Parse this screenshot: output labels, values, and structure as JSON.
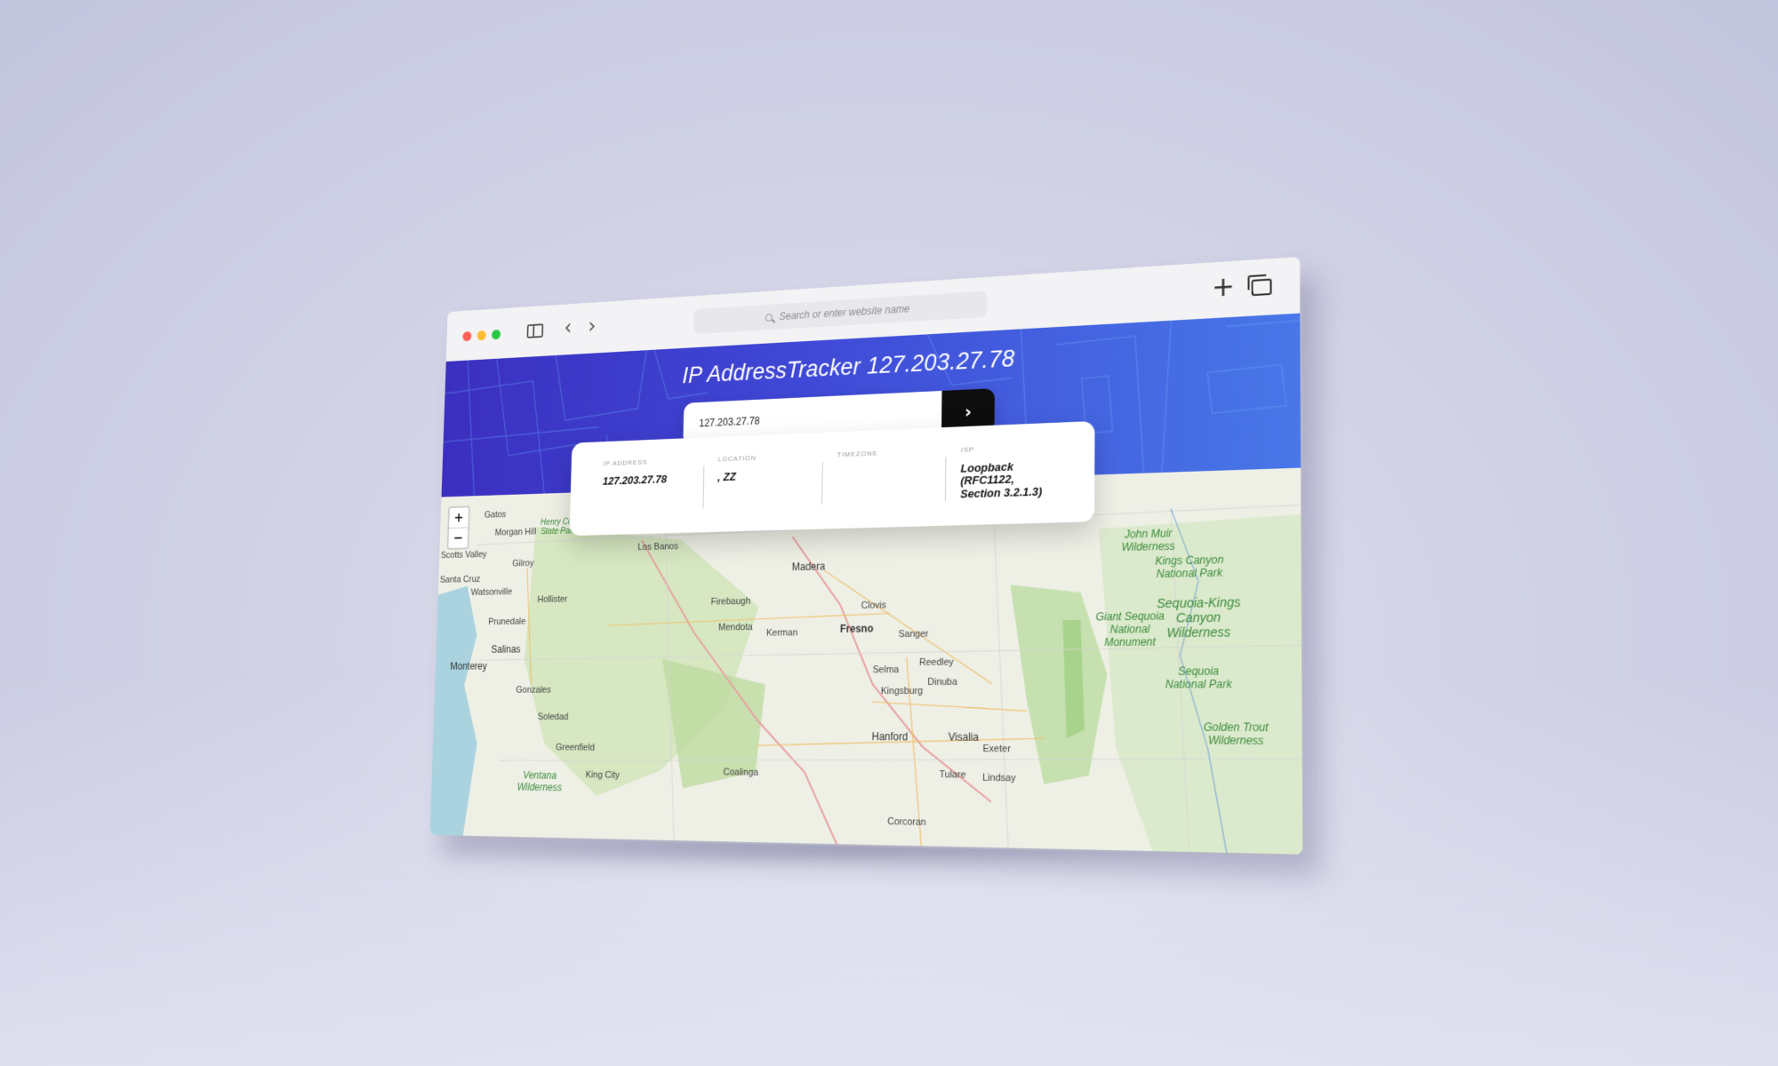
{
  "browser": {
    "address_placeholder": "Search or enter website name",
    "back_glyph": "‹",
    "forward_glyph": "›",
    "new_tab_glyph": "+",
    "icons": [
      "close-dot",
      "minimize-dot",
      "zoom-dot",
      "sidebar-icon",
      "back-icon",
      "forward-icon",
      "search-icon",
      "plus-icon",
      "tabs-overview-icon"
    ]
  },
  "header": {
    "title": "IP AddressTracker 127.203.27.78",
    "gradient": [
      "#3b2fbf",
      "#4877e8"
    ]
  },
  "search": {
    "value": "127.203.27.78",
    "submit_glyph": "›"
  },
  "info": {
    "ip": {
      "label": "IP ADDRESS",
      "value": "127.203.27.78"
    },
    "location": {
      "label": "LOCATION",
      "value": ", ZZ"
    },
    "timezone": {
      "label": "TIMEZONE",
      "value": ""
    },
    "isp": {
      "label": "ISP",
      "value": "Loopback (RFC1122, Section 3.2.1.3)"
    }
  },
  "map": {
    "zoom_in": "+",
    "zoom_out": "−",
    "labels": {
      "gatos": "Gatos",
      "morgan_hill": "Morgan Hill",
      "henry_coe": "Henry Coe State Park",
      "scotts_valley": "Scotts Valley",
      "gilroy": "Gilroy",
      "santa_cruz": "Santa Cruz",
      "watsonville": "Watsonville",
      "hollister": "Hollister",
      "prunedale": "Prunedale",
      "salinas": "Salinas",
      "monterey": "Monterey",
      "gonzales": "Gonzales",
      "soledad": "Soledad",
      "greenfield": "Greenfield",
      "king_city": "King City",
      "ventana": "Ventana Wilderness",
      "los_banos": "Los Banos",
      "madera": "Madera",
      "firebaugh": "Firebaugh",
      "clovis": "Clovis",
      "mendota": "Mendota",
      "kerman": "Kerman",
      "fresno": "Fresno",
      "sanger": "Sanger",
      "reedley": "Reedley",
      "selma": "Selma",
      "dinuba": "Dinuba",
      "kingsburg": "Kingsburg",
      "hanford": "Hanford",
      "visalia": "Visalia",
      "exeter": "Exeter",
      "lindsay": "Lindsay",
      "tulare": "Tulare",
      "coalinga": "Coalinga",
      "corcoran": "Corcoran",
      "john_muir": "John Muir Wilderness",
      "kings_canyon": "Kings Canyon National Park",
      "sequoia_kings": "Sequoia-Kings Canyon Wilderness",
      "giant_sequoia": "Giant Sequoia National Monument",
      "sequoia_np": "Sequoia National Park",
      "golden_trout": "Golden Trout Wilderness"
    }
  }
}
